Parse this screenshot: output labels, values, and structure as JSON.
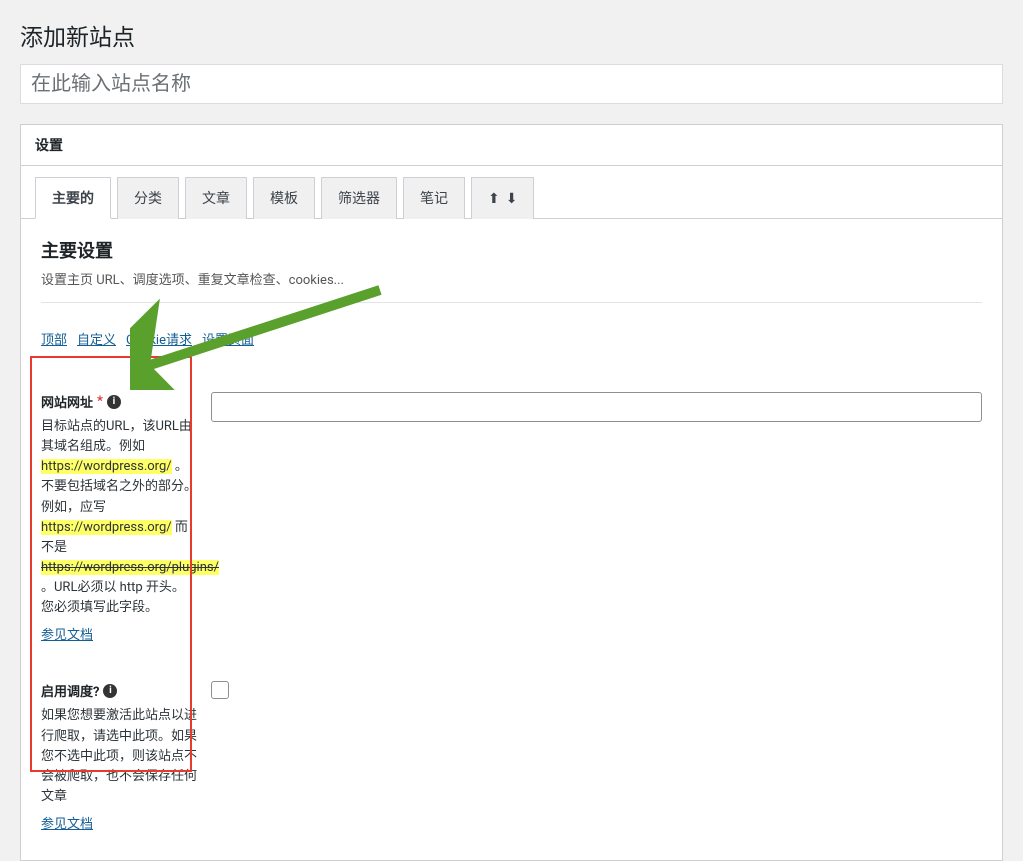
{
  "page_title": "添加新站点",
  "title_placeholder": "在此输入站点名称",
  "panel_header": "设置",
  "tabs": {
    "main": "主要的",
    "category": "分类",
    "article": "文章",
    "template": "模板",
    "filter": "筛选器",
    "notes": "笔记"
  },
  "section": {
    "title": "主要设置",
    "subtitle": "设置主页 URL、调度选项、重复文章检查、cookies..."
  },
  "anchors": {
    "top": "顶部",
    "custom": "自定义",
    "cookie": "Cookie请求",
    "settings_page": "设置页面"
  },
  "fields": {
    "url": {
      "label": "网站网址",
      "desc_before": "目标站点的URL，该URL由其域名组成。例如 ",
      "example1": "https://wordpress.org/",
      "desc_mid1": " 。不要包括域名之外的部分。例如，应写 ",
      "example2": "https://wordpress.org/",
      "desc_mid2": " 而不是 ",
      "example3": "https://wordpress.org/plugins/",
      "desc_after": " 。URL必须以 http 开头。 您必须填写此字段。",
      "doc_link": "参见文档"
    },
    "schedule": {
      "label": "启用调度?",
      "desc": "如果您想要激活此站点以进行爬取，请选中此项。如果您不选中此项，则该站点不会被爬取，也不会保存任何文章",
      "doc_link": "参见文档"
    }
  }
}
